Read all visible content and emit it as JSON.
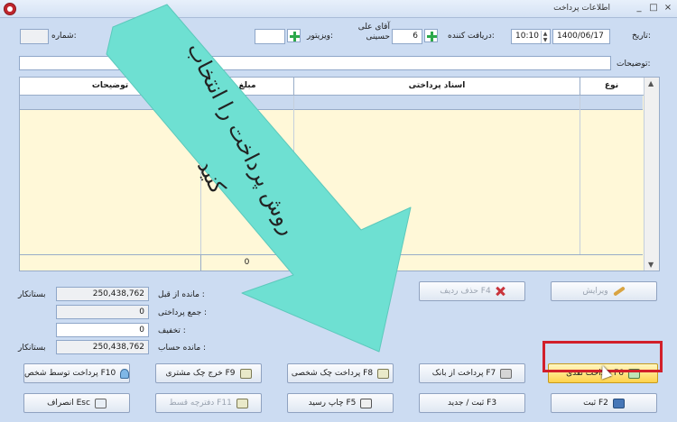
{
  "window": {
    "title": "اطلاعات پرداخت",
    "controls": [
      "_",
      "□",
      "×"
    ]
  },
  "form": {
    "date_label": "تاریخ:",
    "date_value": "1400/06/17",
    "time_value": "10:10",
    "receiver_label": "دریافت کننده:",
    "receiver_code": "6",
    "receiver_name": "آقای علی حسینی",
    "visitor_label": "ویزیتور:",
    "visitor_value": "",
    "number_label": "شماره:",
    "number_value": "",
    "description_label": "توضیحات:",
    "description_value": ""
  },
  "grid": {
    "columns": [
      "نوع",
      "اسناد پرداختی",
      "مبلغ",
      "توضیحات"
    ],
    "rows": [],
    "total_amount": "0"
  },
  "actions": {
    "edit": "ویرایش",
    "delete_row": "حذف ردیف F4"
  },
  "summary": {
    "prev_balance_label": "مانده از قبل :",
    "prev_balance_value": "250,438,762",
    "prev_balance_type": "بستانکار",
    "total_paid_label": "جمع پرداختی :",
    "total_paid_value": "0",
    "discount_label": "تخفیف :",
    "discount_value": "0",
    "account_balance_label": "مانده حساب :",
    "account_balance_value": "250,438,762",
    "account_balance_type": "بستانکار"
  },
  "buttons": {
    "cash_payment": "پرداخت نقدی F6",
    "bank_payment": "پرداخت از بانک F7",
    "personal_check": "پرداخت چک شخصی F8",
    "customer_check": "خرج چک مشتری F9",
    "person_payment": "پرداخت توسط شخص F10",
    "save": "ثبت F2",
    "save_new": "ثبت / جدید F3",
    "print_receipt": "چاپ رسید F5",
    "installment_book": "دفترچه قسط F11",
    "cancel": "انصراف Esc"
  },
  "overlay": {
    "caption_line1": "روش پرداخت را انتخاب",
    "caption_line2": "کنید",
    "arrow_color": "#6ee0d2"
  }
}
